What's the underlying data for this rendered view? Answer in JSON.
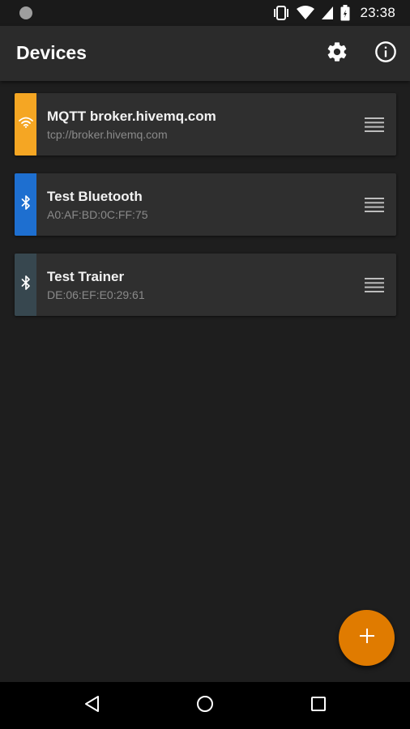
{
  "status_bar": {
    "time": "23:38",
    "icons": [
      "notification-dot-icon",
      "vibrate-icon",
      "wifi-icon",
      "signal-icon",
      "battery-icon"
    ]
  },
  "app_bar": {
    "title": "Devices",
    "actions": [
      "settings-gear-icon",
      "info-icon"
    ]
  },
  "devices": [
    {
      "name": "MQTT broker.hivemq.com",
      "address": "tcp://broker.hivemq.com",
      "type_icon": "wifi-icon",
      "accent_color": "#f5a623"
    },
    {
      "name": "Test Bluetooth",
      "address": "A0:AF:BD:0C:FF:75",
      "type_icon": "bluetooth-icon",
      "accent_color": "#1e6fd0"
    },
    {
      "name": "Test Trainer",
      "address": "DE:06:EF:E0:29:61",
      "type_icon": "bluetooth-icon",
      "accent_color": "#37474f"
    }
  ],
  "fab": {
    "icon": "plus-icon",
    "color": "#e07b00"
  },
  "nav_bar": {
    "buttons": [
      "back-icon",
      "home-icon",
      "recents-icon"
    ]
  }
}
